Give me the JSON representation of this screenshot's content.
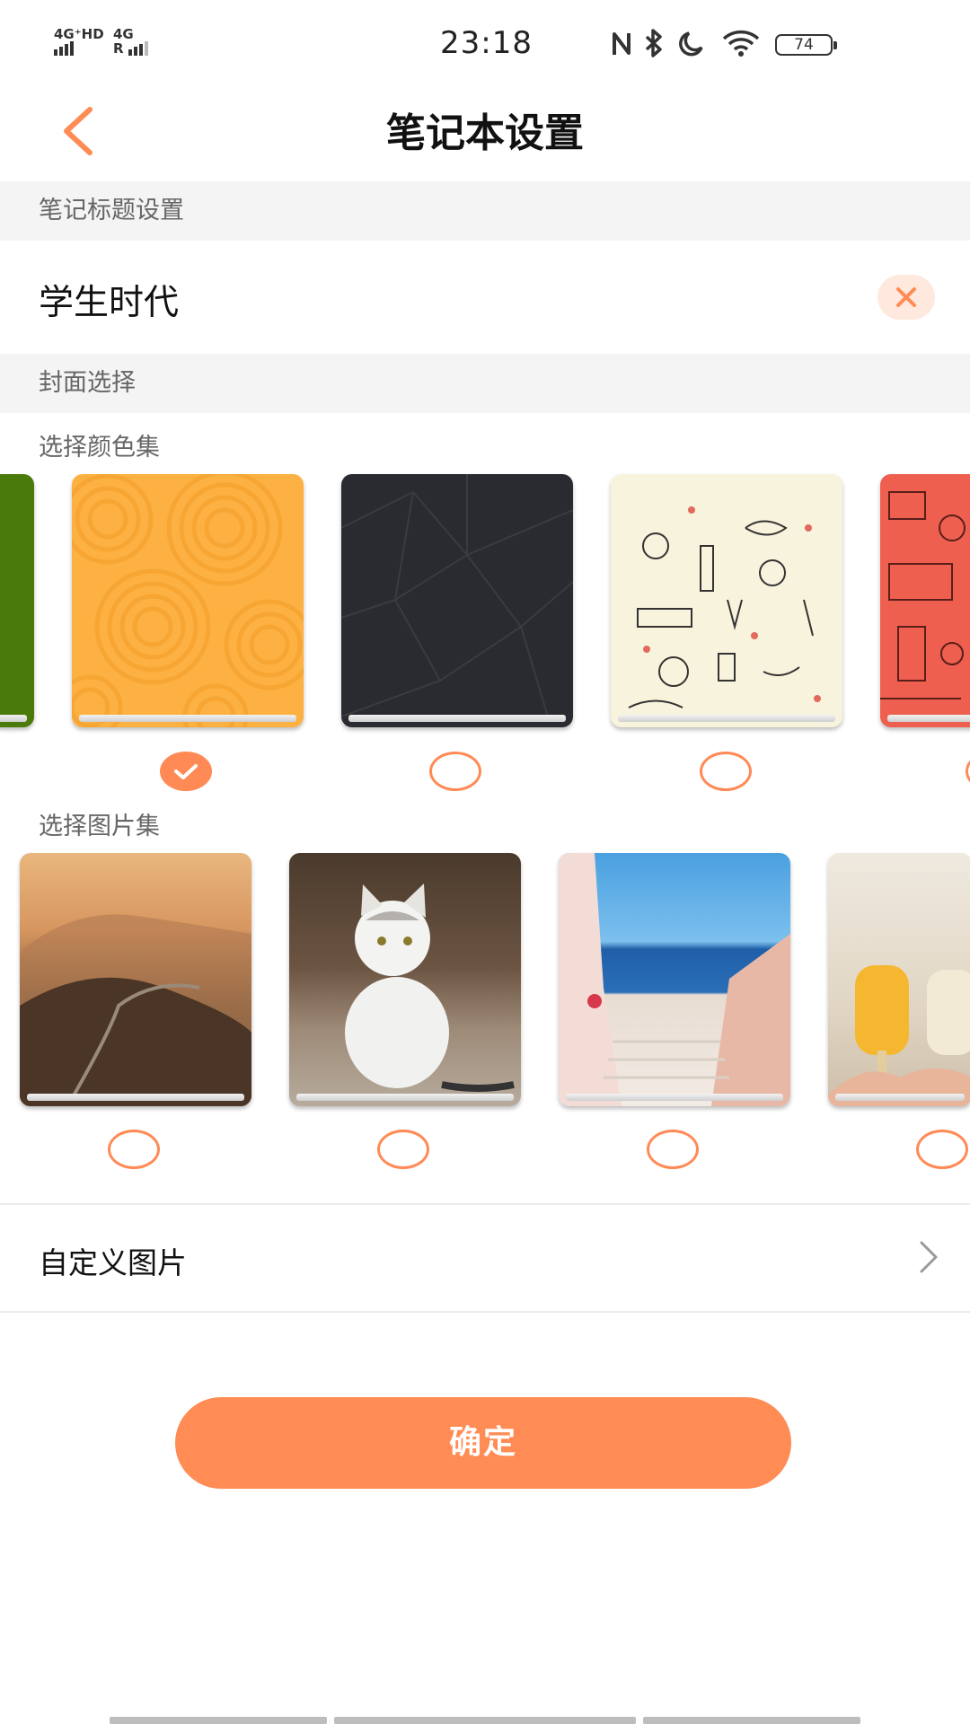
{
  "status_bar": {
    "network_1": "4G⁺HD",
    "network_2": "4G",
    "network_2_prefix": "R",
    "time": "23:18",
    "battery": "74",
    "icons": [
      "nfc-icon",
      "bluetooth-icon",
      "moon-icon",
      "wifi-icon",
      "battery-icon"
    ]
  },
  "header": {
    "title": "笔记本设置",
    "back_icon": "back-icon"
  },
  "title_section": {
    "label": "笔记标题设置",
    "value": "学生时代",
    "clear_icon": "close-icon"
  },
  "cover_section": {
    "label": "封面选择",
    "color_set_label": "选择颜色集",
    "color_covers": [
      {
        "name": "green",
        "selected": false
      },
      {
        "name": "orange-swirl",
        "selected": true
      },
      {
        "name": "dark-geometric",
        "selected": false
      },
      {
        "name": "cream-doodle",
        "selected": false
      },
      {
        "name": "red-doodle",
        "selected": false
      }
    ],
    "image_set_label": "选择图片集",
    "image_covers": [
      {
        "name": "great-wall",
        "selected": false
      },
      {
        "name": "white-cat",
        "selected": false
      },
      {
        "name": "seaside-stairs",
        "selected": false
      },
      {
        "name": "popsicles",
        "selected": false
      }
    ]
  },
  "custom_image": {
    "label": "自定义图片",
    "chevron_icon": "chevron-right-icon"
  },
  "confirm_button": {
    "label": "确定"
  },
  "colors": {
    "accent": "#ff8c55",
    "section_bg": "#f4f4f4",
    "clear_bg": "#ffe8de"
  }
}
